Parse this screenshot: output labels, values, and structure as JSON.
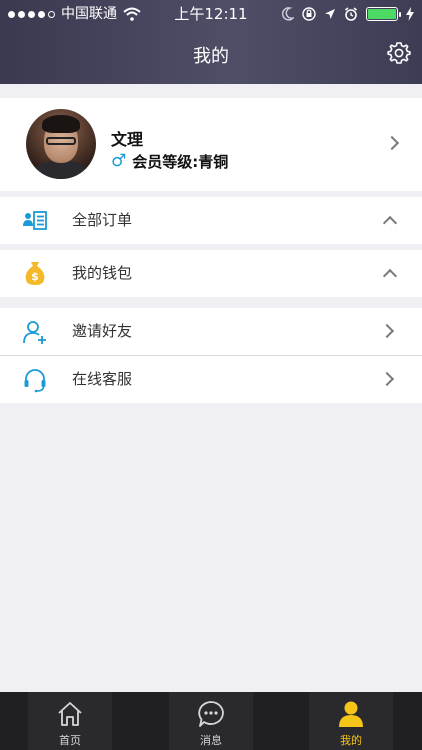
{
  "status_bar": {
    "carrier": "中国联通",
    "time": "上午12:11",
    "battery_level": 1.0
  },
  "nav": {
    "title": "我的",
    "settings_icon": "gear-icon"
  },
  "profile": {
    "name": "文理",
    "gender_symbol": "♂",
    "level_text": "会员等级:青铜"
  },
  "menu": {
    "orders": {
      "label": "全部订单",
      "icon": "order-list-icon"
    },
    "wallet": {
      "label": "我的钱包",
      "icon": "money-bag-icon"
    },
    "invite": {
      "label": "邀请好友",
      "icon": "add-user-icon"
    },
    "service": {
      "label": "在线客服",
      "icon": "headset-icon"
    }
  },
  "tabbar": {
    "home": {
      "label": "首页",
      "icon": "home-icon"
    },
    "messages": {
      "label": "消息",
      "icon": "chat-bubble-icon"
    },
    "mine": {
      "label": "我的",
      "icon": "user-icon"
    }
  },
  "colors": {
    "accent_yellow": "#f5c518",
    "icon_blue": "#1b9ad6",
    "wallet_gold": "#f3b928",
    "battery_green": "#4cd964"
  }
}
